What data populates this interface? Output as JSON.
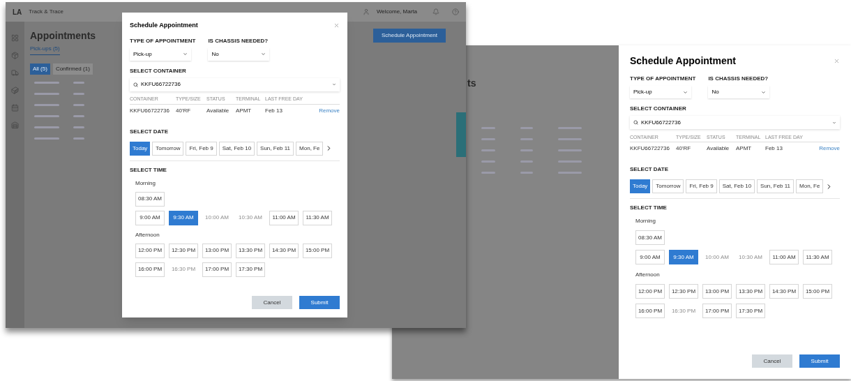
{
  "windows": [
    {
      "kind": "app",
      "logo": "LA",
      "app_name": "Track & Trace",
      "user": "Welcome, Marta",
      "page_title": "Appointments",
      "primary_button": "Schedule Appointment",
      "tabs": [
        {
          "label": "Pick-ups (5)",
          "selected": true
        }
      ],
      "filters": [
        {
          "label": "All (5)",
          "selected": true
        },
        {
          "label": "Confirmed (1)",
          "selected": false
        }
      ],
      "modal": {
        "kind": "dialog",
        "title": "Schedule Appointment",
        "fields": [
          {
            "label": "TYPE OF APPOINTMENT",
            "value": "Pick-up"
          },
          {
            "label": "IS CHASSIS NEEDED?",
            "value": "No"
          }
        ],
        "container": {
          "label": "SELECT CONTAINER",
          "value": "KKFU66722736",
          "columns": [
            "CONTAINER",
            "TYPE/SIZE",
            "STATUS",
            "TERMINAL",
            "LAST FREE DAY"
          ],
          "row": [
            "KKFU66722736",
            "40'RF",
            "Available",
            "APMT",
            "Feb 13"
          ],
          "action": "Remove"
        },
        "date": {
          "label": "SELECT DATE",
          "options": [
            {
              "label": "Today",
              "selected": true
            },
            {
              "label": "Tomorrow",
              "selected": false
            },
            {
              "label": "Fri, Feb 9",
              "selected": false
            },
            {
              "label": "Sat, Feb 10",
              "selected": false
            },
            {
              "label": "Sun, Feb 11",
              "selected": false
            },
            {
              "label": "Mon, Fe",
              "selected": false
            }
          ]
        },
        "time": {
          "label": "SELECT TIME",
          "groups": [
            {
              "name": "Morning",
              "rows": [
                [
                  {
                    "label": "08:30 AM",
                    "selected": false,
                    "disabled": false
                  }
                ],
                [
                  {
                    "label": "9:00 AM",
                    "selected": false,
                    "disabled": false
                  },
                  {
                    "label": "9:30 AM",
                    "selected": true,
                    "disabled": false
                  },
                  {
                    "label": "10:00 AM",
                    "selected": false,
                    "disabled": true
                  },
                  {
                    "label": "10:30 AM",
                    "selected": false,
                    "disabled": true
                  },
                  {
                    "label": "11:00 AM",
                    "selected": false,
                    "disabled": false
                  },
                  {
                    "label": "11:30 AM",
                    "selected": false,
                    "disabled": false
                  }
                ]
              ]
            },
            {
              "name": "Afternoon",
              "rows": [
                [
                  {
                    "label": "12:00 PM",
                    "selected": false,
                    "disabled": false
                  },
                  {
                    "label": "12:30 PM",
                    "selected": false,
                    "disabled": false
                  },
                  {
                    "label": "13:00 PM",
                    "selected": false,
                    "disabled": false
                  },
                  {
                    "label": "13:30 PM",
                    "selected": false,
                    "disabled": false
                  },
                  {
                    "label": "14:30 PM",
                    "selected": false,
                    "disabled": false
                  },
                  {
                    "label": "15:00 PM",
                    "selected": false,
                    "disabled": false
                  }
                ],
                [
                  {
                    "label": "16:00 PM",
                    "selected": false,
                    "disabled": false
                  },
                  {
                    "label": "16:30 PM",
                    "selected": false,
                    "disabled": true
                  },
                  {
                    "label": "17:00 PM",
                    "selected": false,
                    "disabled": false
                  },
                  {
                    "label": "17:30 PM",
                    "selected": false,
                    "disabled": false
                  }
                ]
              ]
            }
          ]
        },
        "buttons": {
          "cancel": "Cancel",
          "submit": "Submit"
        }
      }
    },
    {
      "kind": "drawer",
      "page_title": "ts",
      "modal": {
        "kind": "drawer",
        "title": "Schedule Appointment",
        "fields": [
          {
            "label": "TYPE OF APPOINTMENT",
            "value": "Pick-up"
          },
          {
            "label": "IS CHASSIS NEEDED?",
            "value": "No"
          }
        ],
        "container": {
          "label": "SELECT CONTAINER",
          "value": "KKFU66722736",
          "columns": [
            "CONTAINER",
            "TYPE/SIZE",
            "STATUS",
            "TERMINAL",
            "LAST FREE DAY"
          ],
          "row": [
            "KKFU66722736",
            "40'RF",
            "Available",
            "APMT",
            "Feb 13"
          ],
          "action": "Remove"
        },
        "date": {
          "label": "SELECT DATE",
          "options": [
            {
              "label": "Today",
              "selected": true
            },
            {
              "label": "Tomorrow",
              "selected": false
            },
            {
              "label": "Fri, Feb 9",
              "selected": false
            },
            {
              "label": "Sat, Feb 10",
              "selected": false
            },
            {
              "label": "Sun, Feb 11",
              "selected": false
            },
            {
              "label": "Mon, Fe",
              "selected": false
            }
          ]
        },
        "time": {
          "label": "SELECT TIME",
          "groups": [
            {
              "name": "Morning",
              "rows": [
                [
                  {
                    "label": "08:30 AM",
                    "selected": false,
                    "disabled": false
                  }
                ],
                [
                  {
                    "label": "9:00 AM",
                    "selected": false,
                    "disabled": false
                  },
                  {
                    "label": "9:30 AM",
                    "selected": true,
                    "disabled": false
                  },
                  {
                    "label": "10:00 AM",
                    "selected": false,
                    "disabled": true
                  },
                  {
                    "label": "10:30 AM",
                    "selected": false,
                    "disabled": true
                  },
                  {
                    "label": "11:00 AM",
                    "selected": false,
                    "disabled": false
                  },
                  {
                    "label": "11:30 AM",
                    "selected": false,
                    "disabled": false
                  }
                ]
              ]
            },
            {
              "name": "Afternoon",
              "rows": [
                [
                  {
                    "label": "12:00 PM",
                    "selected": false,
                    "disabled": false
                  },
                  {
                    "label": "12:30 PM",
                    "selected": false,
                    "disabled": false
                  },
                  {
                    "label": "13:00 PM",
                    "selected": false,
                    "disabled": false
                  },
                  {
                    "label": "13:30 PM",
                    "selected": false,
                    "disabled": false
                  },
                  {
                    "label": "14:30 PM",
                    "selected": false,
                    "disabled": false
                  },
                  {
                    "label": "15:00 PM",
                    "selected": false,
                    "disabled": false
                  }
                ],
                [
                  {
                    "label": "16:00 PM",
                    "selected": false,
                    "disabled": false
                  },
                  {
                    "label": "16:30 PM",
                    "selected": false,
                    "disabled": true
                  },
                  {
                    "label": "17:00 PM",
                    "selected": false,
                    "disabled": false
                  },
                  {
                    "label": "17:30 PM",
                    "selected": false,
                    "disabled": false
                  }
                ]
              ]
            }
          ]
        },
        "buttons": {
          "cancel": "Cancel",
          "submit": "Submit"
        }
      }
    }
  ]
}
